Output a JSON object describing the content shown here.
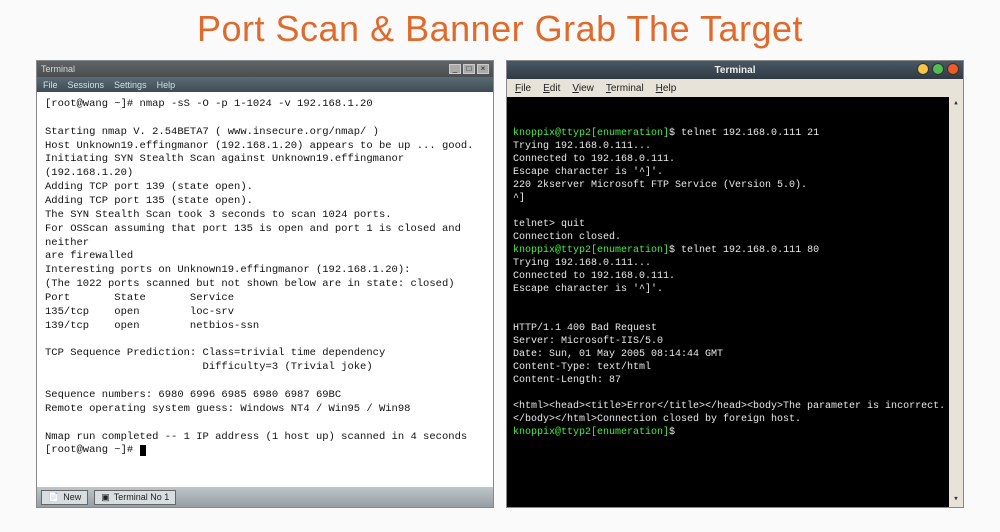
{
  "slide": {
    "title": "Port Scan & Banner Grab The Target"
  },
  "left_terminal": {
    "titlebar": {
      "title": "Terminal"
    },
    "window_buttons": {
      "min": "_",
      "max": "□",
      "close": "×"
    },
    "menubar": {
      "file": "File",
      "sessions": "Sessions",
      "settings": "Settings",
      "help": "Help"
    },
    "lines": [
      "[root@wang ~]# nmap -sS -O -p 1-1024 -v 192.168.1.20",
      "",
      "Starting nmap V. 2.54BETA7 ( www.insecure.org/nmap/ )",
      "Host Unknown19.effingmanor (192.168.1.20) appears to be up ... good.",
      "Initiating SYN Stealth Scan against Unknown19.effingmanor (192.168.1.20)",
      "Adding TCP port 139 (state open).",
      "Adding TCP port 135 (state open).",
      "The SYN Stealth Scan took 3 seconds to scan 1024 ports.",
      "For OSScan assuming that port 135 is open and port 1 is closed and neither",
      "are firewalled",
      "Interesting ports on Unknown19.effingmanor (192.168.1.20):",
      "(The 1022 ports scanned but not shown below are in state: closed)",
      "Port       State       Service",
      "135/tcp    open        loc-srv",
      "139/tcp    open        netbios-ssn",
      "",
      "TCP Sequence Prediction: Class=trivial time dependency",
      "                         Difficulty=3 (Trivial joke)",
      "",
      "Sequence numbers: 6980 6996 6985 6980 6987 69BC",
      "Remote operating system guess: Windows NT4 / Win95 / Win98",
      "",
      "Nmap run completed -- 1 IP address (1 host up) scanned in 4 seconds",
      "[root@wang ~]# "
    ],
    "taskbar": {
      "new": "New",
      "tab": "Terminal No 1"
    }
  },
  "right_terminal": {
    "titlebar": {
      "title": "Terminal"
    },
    "menubar": {
      "file": "File",
      "edit": "Edit",
      "view": "View",
      "terminal": "Terminal",
      "help": "Help"
    },
    "prompt": {
      "user_host": "knoppix@ttyp2",
      "path": "[enumeration]",
      "sep": "$"
    },
    "sessions": [
      {
        "cmd": "telnet 192.168.0.111 21",
        "out": [
          "Trying 192.168.0.111...",
          "Connected to 192.168.0.111.",
          "Escape character is '^]'.",
          "220 2kserver Microsoft FTP Service (Version 5.0).",
          "^]",
          "",
          "telnet> quit",
          "Connection closed."
        ]
      },
      {
        "cmd": "telnet 192.168.0.111 80",
        "out": [
          "Trying 192.168.0.111...",
          "Connected to 192.168.0.111.",
          "Escape character is '^]'.",
          "",
          "",
          "HTTP/1.1 400 Bad Request",
          "Server: Microsoft-IIS/5.0",
          "Date: Sun, 01 May 2005 08:14:44 GMT",
          "Content-Type: text/html",
          "Content-Length: 87",
          "",
          "<html><head><title>Error</title></head><body>The parameter is incorrect. </body></html>Connection closed by foreign host."
        ]
      }
    ],
    "trailing_prompt": true
  }
}
